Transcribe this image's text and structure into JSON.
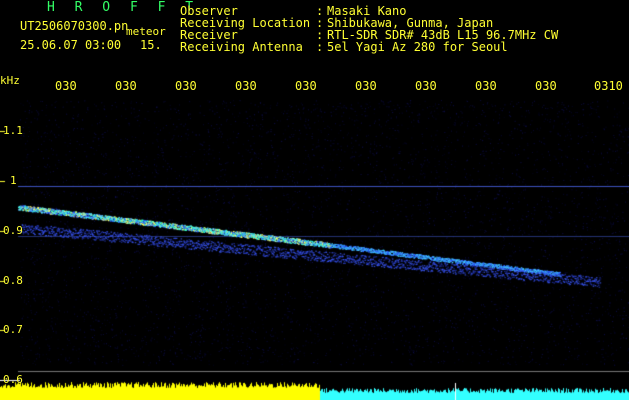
{
  "header": {
    "brand": "H R O F F T",
    "filename": "UT2506070300.pn",
    "tag": "meteor",
    "datetime": "25.06.07 03:00",
    "number": "15.",
    "fields": [
      {
        "label": "Observer",
        "sep": ":",
        "value": "Masaki Kano"
      },
      {
        "label": "Receiving Location",
        "sep": ":",
        "value": "Shibukawa, Gunma, Japan"
      },
      {
        "label": "Receiver",
        "sep": ":",
        "value": "RTL-SDR SDR# 43dB L15 96.7MHz CW"
      },
      {
        "label": "Receiving Antenna",
        "sep": ":",
        "value": "5el Yagi Az 280 for Seoul"
      }
    ]
  },
  "axis": {
    "unit": "kHz",
    "x_ticks": [
      "030",
      "030",
      "030",
      "030",
      "030",
      "030",
      "030",
      "030",
      "030",
      "0310"
    ],
    "y_ticks": [
      "1.1",
      "1",
      "0.9",
      "0.8",
      "0.7",
      "0.6"
    ]
  },
  "colors": {
    "background": "#000000",
    "text": "#ffff33",
    "brand": "#33ff66",
    "signal_low": "#3344ff",
    "signal_mid": "#33ffcc",
    "signal_high": "#ffff66",
    "bar_left": "#ffff00",
    "bar_right": "#33ffff"
  }
}
